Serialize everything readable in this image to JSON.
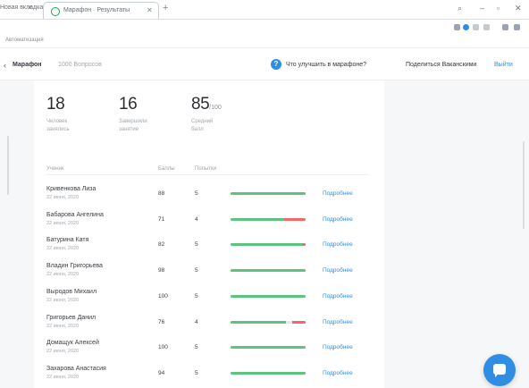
{
  "browser": {
    "prev_tab_label": "Новая вкладка",
    "active_tab_label": "Марафон · Результаты",
    "bookmark_label": "Автоматизация"
  },
  "header": {
    "title": "Марафон",
    "subtitle": "1000 Вопросов",
    "help_label": "Что улучшить в марафоне?",
    "share_label": "Поделиться Ваканскими",
    "logout_label": "Выйти"
  },
  "stats": [
    {
      "value": "18",
      "unit": "",
      "label": "Человек\nзанялись"
    },
    {
      "value": "16",
      "unit": "",
      "label": "Завершили\nзанятие"
    },
    {
      "value": "85",
      "unit": "/100",
      "label": "Средний\nбалл"
    }
  ],
  "table": {
    "headers": {
      "name": "Ученик",
      "score": "Баллы",
      "attempts": "Попытки"
    },
    "more_label": "Подробнее",
    "rows": [
      {
        "name": "Кривенкова Лиза",
        "date": "22 июня, 2020",
        "score": "88",
        "attempts": "5",
        "correct": 1.0,
        "wrong": 0.0
      },
      {
        "name": "Бабарова Ангелина",
        "date": "22 июня, 2020",
        "score": "71",
        "attempts": "4",
        "correct": 0.72,
        "wrong": 0.28
      },
      {
        "name": "Батурина Катя",
        "date": "22 июня, 2020",
        "score": "82",
        "attempts": "5",
        "correct": 0.96,
        "wrong": 0.04
      },
      {
        "name": "Владин Григорьева",
        "date": "22 июня, 2020",
        "score": "98",
        "attempts": "5",
        "correct": 1.0,
        "wrong": 0.0
      },
      {
        "name": "Выродов Михаил",
        "date": "22 июня, 2020",
        "score": "100",
        "attempts": "5",
        "correct": 1.0,
        "wrong": 0.0
      },
      {
        "name": "Григорьев Данил",
        "date": "22 июня, 2020",
        "score": "76",
        "attempts": "4",
        "correct": 0.74,
        "wrong": 0.18
      },
      {
        "name": "Домащук Алексей",
        "date": "22 июня, 2020",
        "score": "100",
        "attempts": "5",
        "correct": 1.0,
        "wrong": 0.0
      },
      {
        "name": "Захарова Анастасия",
        "date": "22 июня, 2020",
        "score": "94",
        "attempts": "5",
        "correct": 1.0,
        "wrong": 0.0
      }
    ]
  },
  "colors": {
    "accent": "#2f8de4",
    "correct": "#5cc47e",
    "wrong": "#ef6b6b"
  }
}
